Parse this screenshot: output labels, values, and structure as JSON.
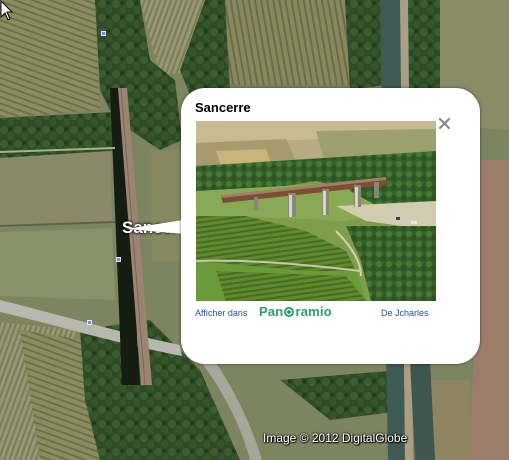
{
  "map": {
    "place_label": "Sancerre",
    "copyright": "Image © 2012 DigitalGlobe"
  },
  "balloon": {
    "title": "Sancerre",
    "view_prefix": "Afficher dans",
    "brand_pre": "Pan",
    "brand_post": "ramio",
    "author": "De Jcharles",
    "close_icon": "close-icon"
  },
  "colors": {
    "link": "#1c54a8",
    "panoramio_green": "#2fa06a",
    "pin": "#6d8cf0"
  }
}
